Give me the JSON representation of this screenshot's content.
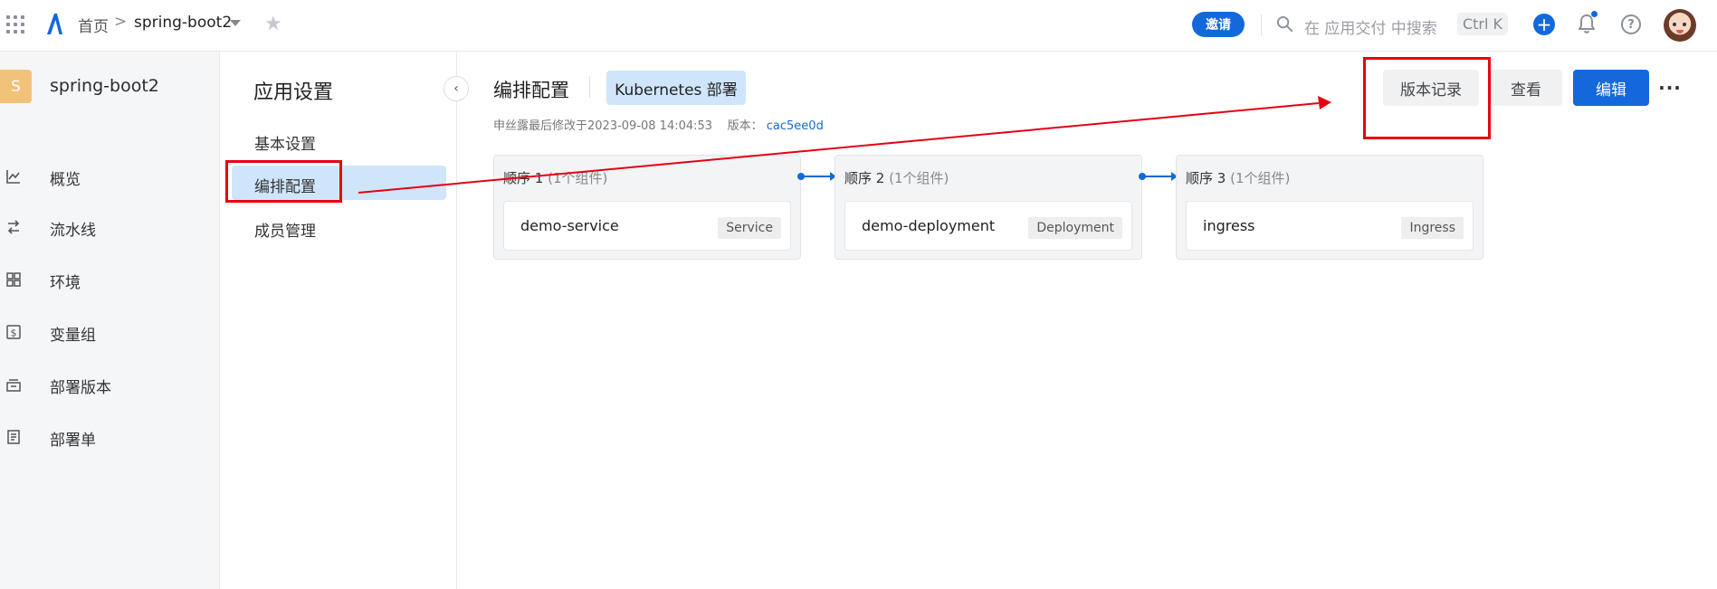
{
  "topbar": {
    "home": "首页",
    "separator": ">",
    "app_name": "spring-boot2",
    "invite_label": "邀请",
    "search_placeholder": "在 应用交付 中搜索",
    "shortcut": "Ctrl K",
    "plus": "+",
    "help": "?"
  },
  "sidebar": {
    "app_initial": "S",
    "app_name": "spring-boot2",
    "items": [
      {
        "label": "概览",
        "icon": "chart-line-icon"
      },
      {
        "label": "流水线",
        "icon": "pipeline-icon"
      },
      {
        "label": "环境",
        "icon": "grid-icon"
      },
      {
        "label": "变量组",
        "icon": "dollar-box-icon"
      },
      {
        "label": "部署版本",
        "icon": "archive-icon"
      },
      {
        "label": "部署单",
        "icon": "document-icon"
      }
    ]
  },
  "submenu": {
    "title": "应用设置",
    "collapse": "‹",
    "items": [
      {
        "label": "基本设置"
      },
      {
        "label": "编排配置",
        "active": true
      },
      {
        "label": "成员管理"
      }
    ]
  },
  "main": {
    "title": "编排配置",
    "deploy_tag": "Kubernetes 部署",
    "meta_prefix": "申丝露最后修改于2023-09-08 14:04:53",
    "meta_version_label": "版本：",
    "meta_version": "cac5ee0d",
    "buttons": {
      "history": "版本记录",
      "view": "查看",
      "edit": "编辑",
      "more": "···"
    },
    "stages": [
      {
        "title": "顺序 1",
        "count": "(1个组件)",
        "component": "demo-service",
        "kind": "Service"
      },
      {
        "title": "顺序 2",
        "count": "(1个组件)",
        "component": "demo-deployment",
        "kind": "Deployment"
      },
      {
        "title": "顺序 3",
        "count": "(1个组件)",
        "component": "ingress",
        "kind": "Ingress"
      }
    ]
  },
  "colors": {
    "primary": "#1468dc",
    "active_bg": "#cfe5fb",
    "annotation": "#e60012"
  }
}
